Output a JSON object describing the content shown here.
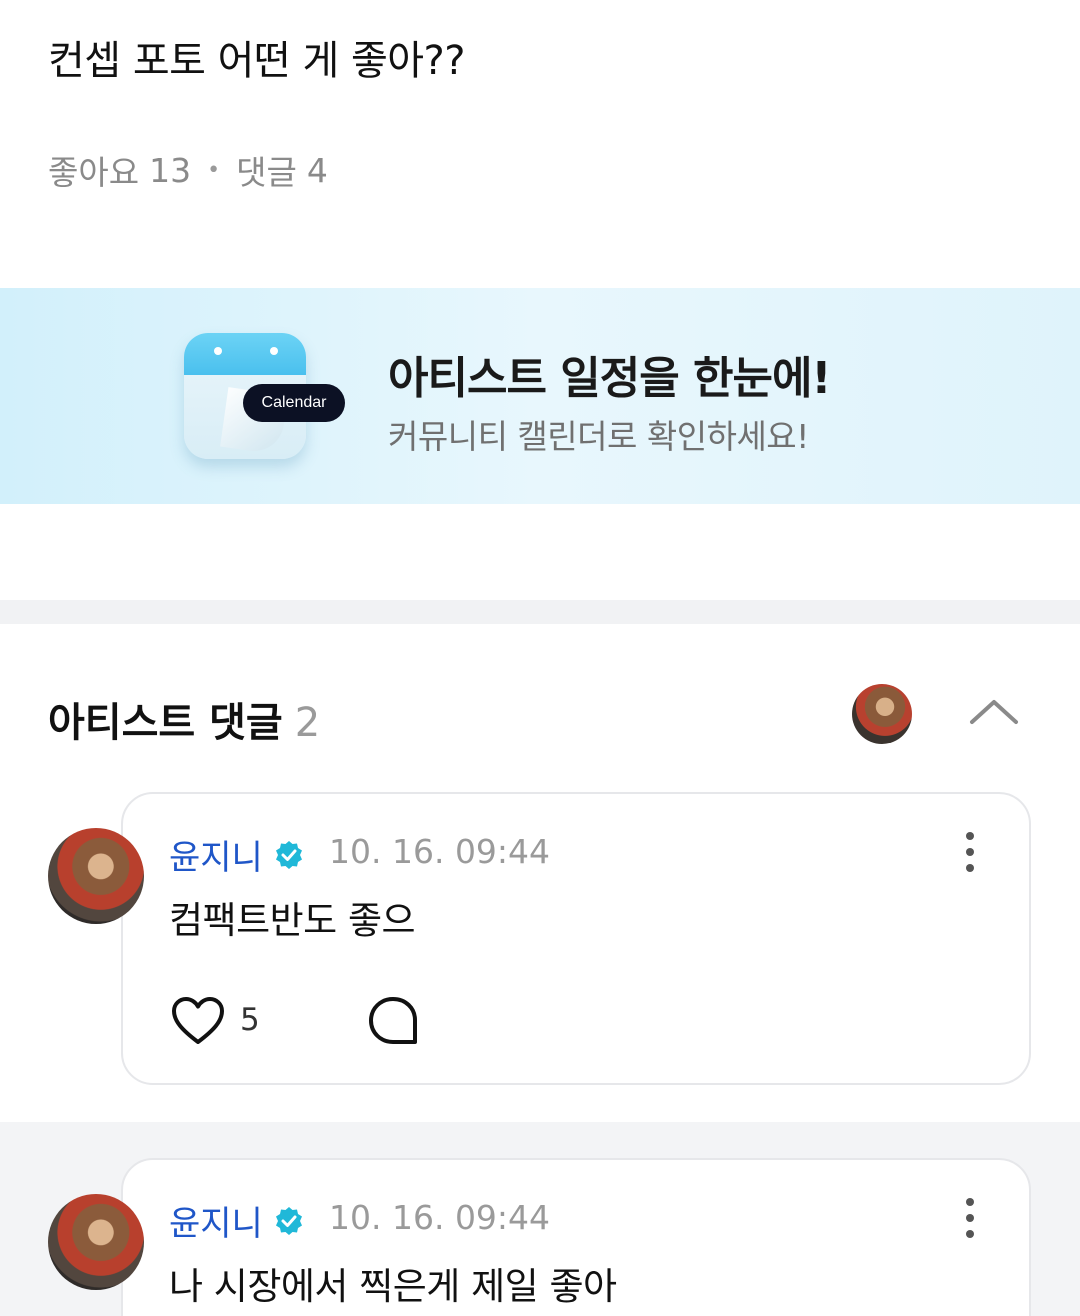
{
  "post": {
    "title": "컨셉 포토 어떤 게 좋아??",
    "likes_label": "좋아요",
    "likes_count": "13",
    "comments_label": "댓글",
    "comments_count": "4"
  },
  "banner": {
    "tag": "Calendar",
    "title": "아티스트 일정을 한눈에!",
    "subtitle": "커뮤니티 캘린더로 확인하세요!",
    "colors": {
      "calendar_top": "#4ac0ee",
      "tag_bg": "#0c1124"
    }
  },
  "artist_comments": {
    "heading": "아티스트 댓글",
    "count": "2",
    "collapse_icon": "chevron-up-icon"
  },
  "comments": [
    {
      "author": "윤지니",
      "verified": true,
      "time": "10. 16. 09:44",
      "text": "컴팩트반도 좋으",
      "like_count": "5"
    },
    {
      "author": "윤지니",
      "verified": true,
      "time": "10. 16. 09:44",
      "text": "나 시장에서 찍은게 제일 좋아"
    }
  ],
  "colors": {
    "author": "#1f56c8",
    "verified": "#20b8d8"
  }
}
